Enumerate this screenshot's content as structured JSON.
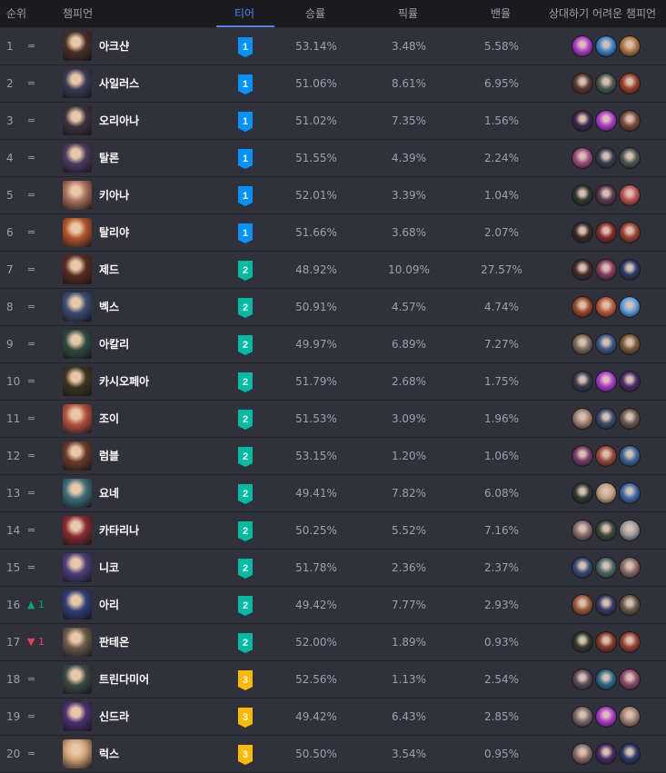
{
  "headers": {
    "rank": "순위",
    "champion": "챔피언",
    "tier": "티어",
    "win_rate": "승률",
    "pick_rate": "픽률",
    "ban_rate": "밴율",
    "counters": "상대하기 어려운 챔피언"
  },
  "colors": {
    "tier1": "#0093ff",
    "tier2": "#00bba3",
    "tier3": "#ffb900",
    "accent": "#5383e8",
    "up": "#00a37f",
    "down": "#e84057"
  },
  "rows": [
    {
      "rank": "1",
      "change": "=",
      "name": "아크샨",
      "tier": "1",
      "win_rate": "53.14%",
      "pick_rate": "3.48%",
      "ban_rate": "5.58%"
    },
    {
      "rank": "2",
      "change": "=",
      "name": "사일러스",
      "tier": "1",
      "win_rate": "51.06%",
      "pick_rate": "8.61%",
      "ban_rate": "6.95%"
    },
    {
      "rank": "3",
      "change": "=",
      "name": "오리아나",
      "tier": "1",
      "win_rate": "51.02%",
      "pick_rate": "7.35%",
      "ban_rate": "1.56%"
    },
    {
      "rank": "4",
      "change": "=",
      "name": "탈론",
      "tier": "1",
      "win_rate": "51.55%",
      "pick_rate": "4.39%",
      "ban_rate": "2.24%"
    },
    {
      "rank": "5",
      "change": "=",
      "name": "키아나",
      "tier": "1",
      "win_rate": "52.01%",
      "pick_rate": "3.39%",
      "ban_rate": "1.04%"
    },
    {
      "rank": "6",
      "change": "=",
      "name": "탈리야",
      "tier": "1",
      "win_rate": "51.66%",
      "pick_rate": "3.68%",
      "ban_rate": "2.07%"
    },
    {
      "rank": "7",
      "change": "=",
      "name": "제드",
      "tier": "2",
      "win_rate": "48.92%",
      "pick_rate": "10.09%",
      "ban_rate": "27.57%"
    },
    {
      "rank": "8",
      "change": "=",
      "name": "벡스",
      "tier": "2",
      "win_rate": "50.91%",
      "pick_rate": "4.57%",
      "ban_rate": "4.74%"
    },
    {
      "rank": "9",
      "change": "=",
      "name": "아칼리",
      "tier": "2",
      "win_rate": "49.97%",
      "pick_rate": "6.89%",
      "ban_rate": "7.27%"
    },
    {
      "rank": "10",
      "change": "=",
      "name": "카시오페아",
      "tier": "2",
      "win_rate": "51.79%",
      "pick_rate": "2.68%",
      "ban_rate": "1.75%"
    },
    {
      "rank": "11",
      "change": "=",
      "name": "조이",
      "tier": "2",
      "win_rate": "51.53%",
      "pick_rate": "3.09%",
      "ban_rate": "1.96%"
    },
    {
      "rank": "12",
      "change": "=",
      "name": "럼블",
      "tier": "2",
      "win_rate": "53.15%",
      "pick_rate": "1.20%",
      "ban_rate": "1.06%"
    },
    {
      "rank": "13",
      "change": "=",
      "name": "요네",
      "tier": "2",
      "win_rate": "49.41%",
      "pick_rate": "7.82%",
      "ban_rate": "6.08%"
    },
    {
      "rank": "14",
      "change": "=",
      "name": "카타리나",
      "tier": "2",
      "win_rate": "50.25%",
      "pick_rate": "5.52%",
      "ban_rate": "7.16%"
    },
    {
      "rank": "15",
      "change": "=",
      "name": "니코",
      "tier": "2",
      "win_rate": "51.78%",
      "pick_rate": "2.36%",
      "ban_rate": "2.37%"
    },
    {
      "rank": "16",
      "change": "▲ 1",
      "name": "아리",
      "tier": "2",
      "win_rate": "49.42%",
      "pick_rate": "7.77%",
      "ban_rate": "2.93%"
    },
    {
      "rank": "17",
      "change": "▼ 1",
      "name": "판테온",
      "tier": "2",
      "win_rate": "52.00%",
      "pick_rate": "1.89%",
      "ban_rate": "0.93%"
    },
    {
      "rank": "18",
      "change": "=",
      "name": "트린다미어",
      "tier": "3",
      "win_rate": "52.56%",
      "pick_rate": "1.13%",
      "ban_rate": "2.54%"
    },
    {
      "rank": "19",
      "change": "=",
      "name": "신드라",
      "tier": "3",
      "win_rate": "49.42%",
      "pick_rate": "6.43%",
      "ban_rate": "2.85%"
    },
    {
      "rank": "20",
      "change": "=",
      "name": "럭스",
      "tier": "3",
      "win_rate": "50.50%",
      "pick_rate": "3.54%",
      "ban_rate": "0.95%"
    }
  ],
  "champion_icon_colors": [
    "#4a2f28",
    "#3b3a55",
    "#3c3340",
    "#4b3a5f",
    "#a8705a",
    "#b4542a",
    "#5a2b22",
    "#3a4d75",
    "#2f4a3f",
    "#3c3520",
    "#b5503f",
    "#6a3a2a",
    "#3c6d7a",
    "#8a2a30",
    "#4b3f7a",
    "#2f3f7a",
    "#6a5a4a",
    "#3a4a45",
    "#4a3070",
    "#d0a070"
  ],
  "counter_icon_colors": [
    [
      "#b23ad0",
      "#3a86c9",
      "#b07840"
    ],
    [
      "#5a3a30",
      "#4a5a50",
      "#a0402a"
    ],
    [
      "#3a2a50",
      "#b23ad0",
      "#7a4a3a"
    ],
    [
      "#a04a80",
      "#3a3a50",
      "#4a5a50"
    ],
    [
      "#2f3a2f",
      "#5a3a50",
      "#c05050"
    ],
    [
      "#3a2a2a",
      "#8a2a2a",
      "#a04030"
    ],
    [
      "#4a2a2a",
      "#8a3a60",
      "#2a3a6a"
    ],
    [
      "#a04a2a",
      "#c05a3a",
      "#5aa0e0"
    ],
    [
      "#7a6a5a",
      "#3a5a8a",
      "#7a5a3a"
    ],
    [
      "#3a3a50",
      "#b23ad0",
      "#4a2a6a"
    ],
    [
      "#a08070",
      "#3a4a6a",
      "#6a5a4a"
    ],
    [
      "#7a3a6a",
      "#a04a3a",
      "#3a6a9a"
    ],
    [
      "#2f3a2f",
      "#c0a080",
      "#3a6ab0"
    ],
    [
      "#8a6a6a",
      "#3a4a3a",
      "#9a9a9a"
    ],
    [
      "#3a4a7a",
      "#4a6a6a",
      "#8a6a6a"
    ],
    [
      "#a05a3a",
      "#3a3a6a",
      "#6a5a4a"
    ],
    [
      "#2f3a2f",
      "#8a3a2a",
      "#a04030"
    ],
    [
      "#5a4a5a",
      "#2a6a8a",
      "#8a4a70"
    ],
    [
      "#7a6a6a",
      "#b23ad0",
      "#a08070"
    ],
    [
      "#8a6a6a",
      "#4a2a6a",
      "#2a3a6a"
    ]
  ]
}
